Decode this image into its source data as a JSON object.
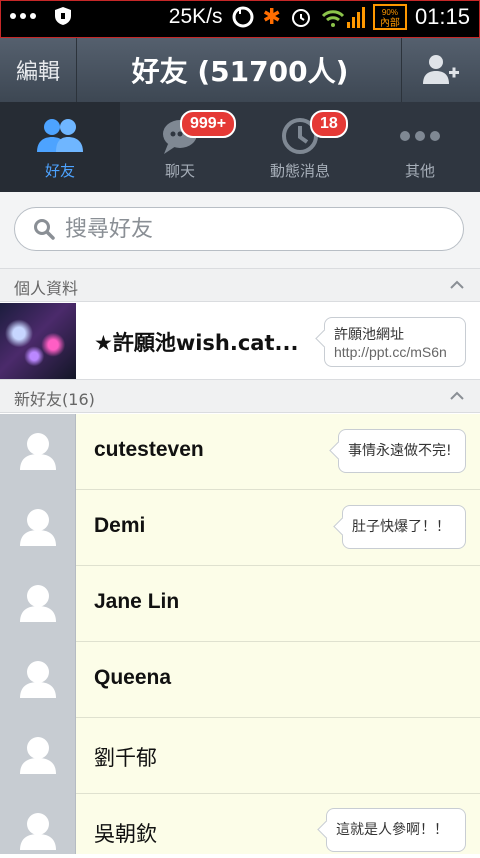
{
  "status_bar": {
    "net_speed": "25K/s",
    "battery_percent": "90%",
    "battery_label": "內部",
    "time": "01:15"
  },
  "header": {
    "edit_label": "編輯",
    "title": "好友 (51700人)"
  },
  "tabs": [
    {
      "label": "好友",
      "icon": "friends-icon",
      "active": true
    },
    {
      "label": "聊天",
      "icon": "chat-icon",
      "badge": "999+"
    },
    {
      "label": "動態消息",
      "icon": "clock-icon",
      "badge": "18"
    },
    {
      "label": "其他",
      "icon": "more-icon"
    }
  ],
  "search": {
    "placeholder": "搜尋好友"
  },
  "sections": {
    "profile_title": "個人資料",
    "new_friends_title": "新好友",
    "new_friends_count": "(16)"
  },
  "profile": {
    "name": "★許願池wish.cat...",
    "bubble_line1": "許願池網址",
    "bubble_line2": "http://ppt.cc/mS6n"
  },
  "friends": [
    {
      "name": "cutesteven",
      "status": "事情永遠做不完!"
    },
    {
      "name": "Demi",
      "status": "肚子快爆了！！"
    },
    {
      "name": "Jane Lin",
      "status": ""
    },
    {
      "name": "Queena",
      "status": ""
    },
    {
      "name": "劉千郁",
      "status": ""
    },
    {
      "name": "吳朝欽",
      "status": "這就是人參啊！！"
    }
  ],
  "colors": {
    "accent": "#4da3ff",
    "badge": "#e53935",
    "header": "#4a5562",
    "row_bg": "#fcfde8"
  }
}
